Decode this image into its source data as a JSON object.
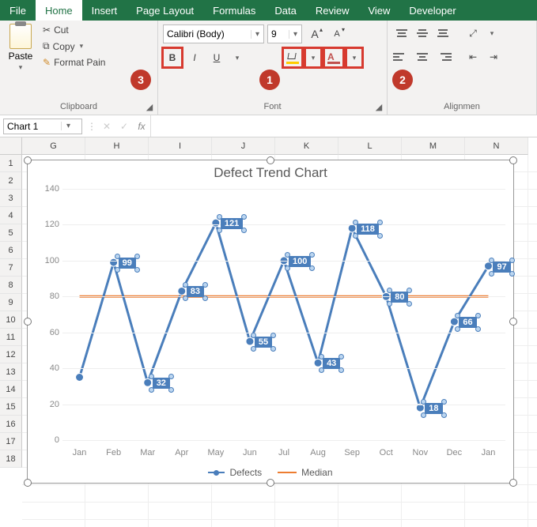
{
  "tabs": [
    "File",
    "Home",
    "Insert",
    "Page Layout",
    "Formulas",
    "Data",
    "Review",
    "View",
    "Developer"
  ],
  "active_tab": "Home",
  "clipboard": {
    "paste": "Paste",
    "cut": "Cut",
    "copy": "Copy",
    "format_painter": "Format Pain",
    "group_label": "Clipboard"
  },
  "font": {
    "name": "Calibri (Body)",
    "size": "9",
    "group_label": "Font",
    "bold": "B",
    "italic": "I",
    "underline": "U",
    "grow": "A",
    "shrink": "A"
  },
  "alignment": {
    "group_label": "Alignmen"
  },
  "callouts": {
    "c1": "1",
    "c2": "2",
    "c3": "3"
  },
  "namebox": "Chart 1",
  "fx_label": "fx",
  "columns": [
    "G",
    "H",
    "I",
    "J",
    "K",
    "L",
    "M",
    "N"
  ],
  "row_count": 18,
  "chart_data": {
    "type": "line",
    "title": "Defect Trend Chart",
    "ylim": [
      0,
      140
    ],
    "ytick": 20,
    "categories": [
      "Jan",
      "Feb",
      "Mar",
      "Apr",
      "May",
      "Jun",
      "Jul",
      "Aug",
      "Sep",
      "Oct",
      "Nov",
      "Dec",
      "Jan"
    ],
    "series": [
      {
        "name": "Defects",
        "color": "#4a7ebb",
        "values": [
          35,
          99,
          32,
          83,
          121,
          55,
          100,
          43,
          118,
          80,
          18,
          66,
          97
        ],
        "labels_selected": true
      },
      {
        "name": "Median",
        "color": "#ed7d31",
        "const": 80
      }
    ]
  }
}
